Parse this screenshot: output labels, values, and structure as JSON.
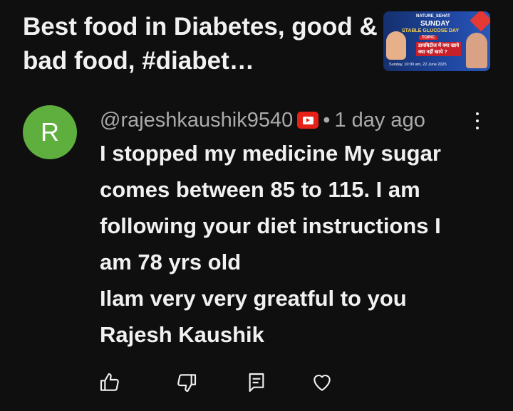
{
  "video": {
    "title": "Best food in Diabetes, good & bad food, #diabet…",
    "thumbnail": {
      "brand": "NATURE_SEHAT",
      "day": "SUNDAY",
      "subtitle": "STABLE GLUCOSE DAY",
      "topic": "TOPIC",
      "hindi_line1": "डायबिटीज में क्या खाये",
      "hindi_line2": "क्या नहीं खाये ?",
      "date": "Sunday, 10:00 am, 22 June 2025"
    }
  },
  "comment": {
    "avatar_letter": "R",
    "avatar_color": "#5faf3f",
    "author": "@rajeshkaushik9540",
    "separator": "•",
    "time": "1 day ago",
    "lines": [
      "I stopped my medicine My sugar",
      "comes between 85 to 115.  I am",
      "following your diet instructions I",
      "am 78 yrs old",
      "Ilam very very greatful to you",
      "Rajesh Kaushik"
    ]
  },
  "actions": {
    "icons": [
      "thumbs-up-icon",
      "thumbs-down-icon",
      "reply-icon",
      "heart-icon"
    ]
  },
  "colors": {
    "background": "#0f0f0f",
    "text": "#f1f1f1",
    "meta": "#aaaaaa",
    "badge_red": "#e62117"
  }
}
